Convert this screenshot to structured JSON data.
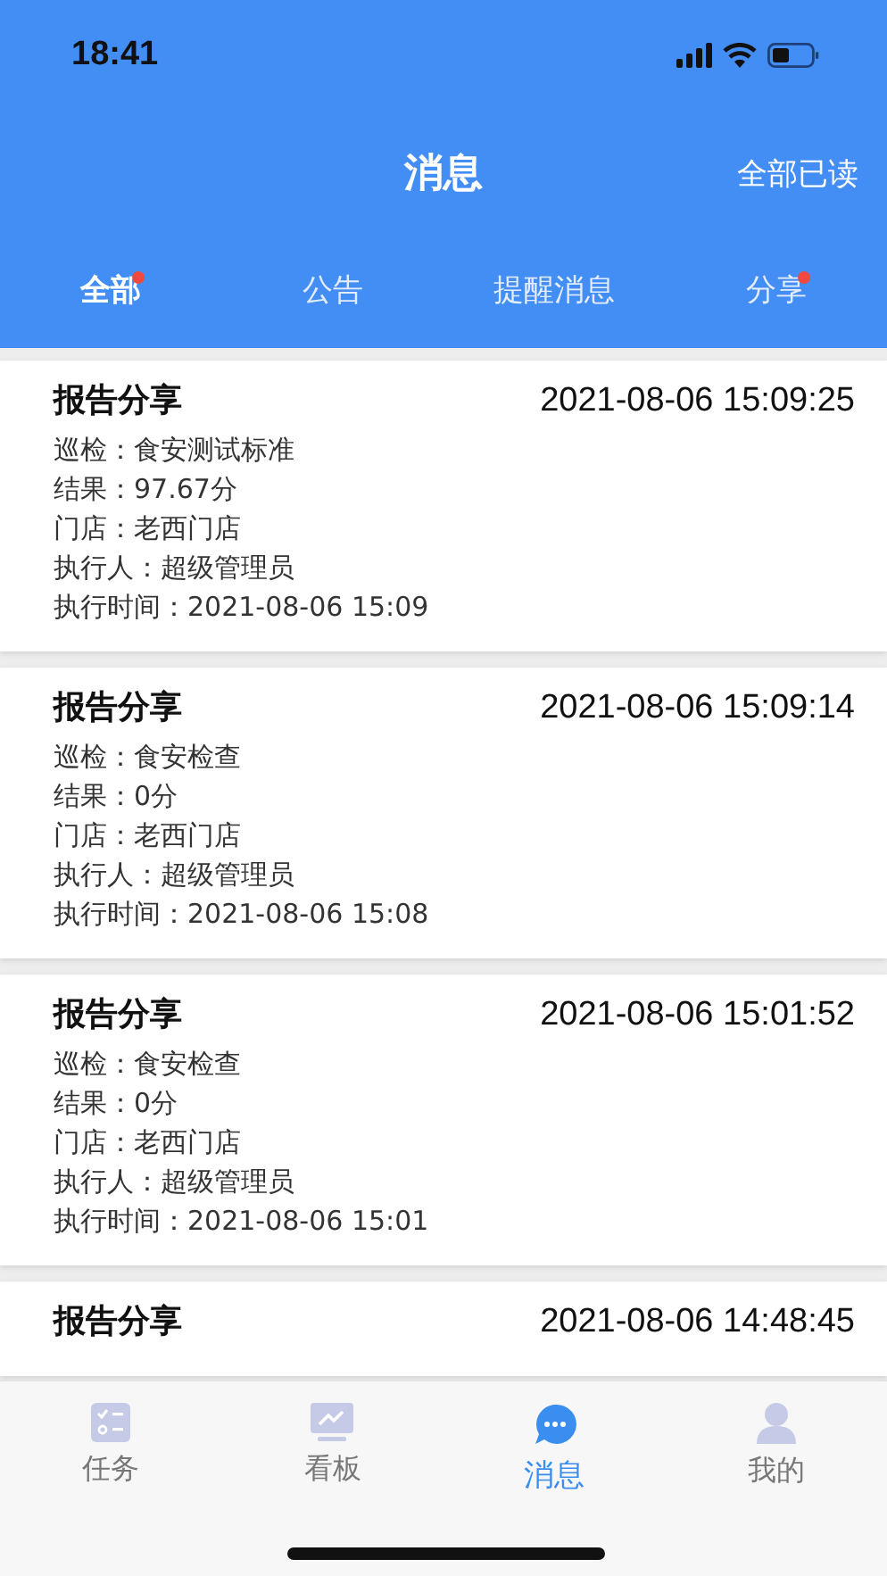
{
  "status_bar": {
    "time": "18:41"
  },
  "header": {
    "title": "消息",
    "action": "全部已读"
  },
  "tabs": [
    {
      "label": "全部",
      "selected": true,
      "unread": true
    },
    {
      "label": "公告",
      "selected": false,
      "unread": false
    },
    {
      "label": "提醒消息",
      "selected": false,
      "unread": false
    },
    {
      "label": "分享",
      "selected": false,
      "unread": true
    }
  ],
  "messages": [
    {
      "title": "报告分享",
      "time": "2021-08-06 15:09:25",
      "lines": [
        "巡检：食安测试标准",
        "结果：97.67分",
        "门店：老西门店",
        "执行人：超级管理员",
        "执行时间：2021-08-06 15:09"
      ]
    },
    {
      "title": "报告分享",
      "time": "2021-08-06 15:09:14",
      "lines": [
        "巡检：食安检查",
        "结果：0分",
        "门店：老西门店",
        "执行人：超级管理员",
        "执行时间：2021-08-06 15:08"
      ]
    },
    {
      "title": "报告分享",
      "time": "2021-08-06 15:01:52",
      "lines": [
        "巡检：食安检查",
        "结果：0分",
        "门店：老西门店",
        "执行人：超级管理员",
        "执行时间：2021-08-06 15:01"
      ]
    },
    {
      "title": "报告分享",
      "time": "2021-08-06 14:48:45"
    }
  ],
  "bottom_nav": [
    {
      "label": "任务",
      "selected": false
    },
    {
      "label": "看板",
      "selected": false
    },
    {
      "label": "消息",
      "selected": true
    },
    {
      "label": "我的",
      "selected": false
    }
  ]
}
